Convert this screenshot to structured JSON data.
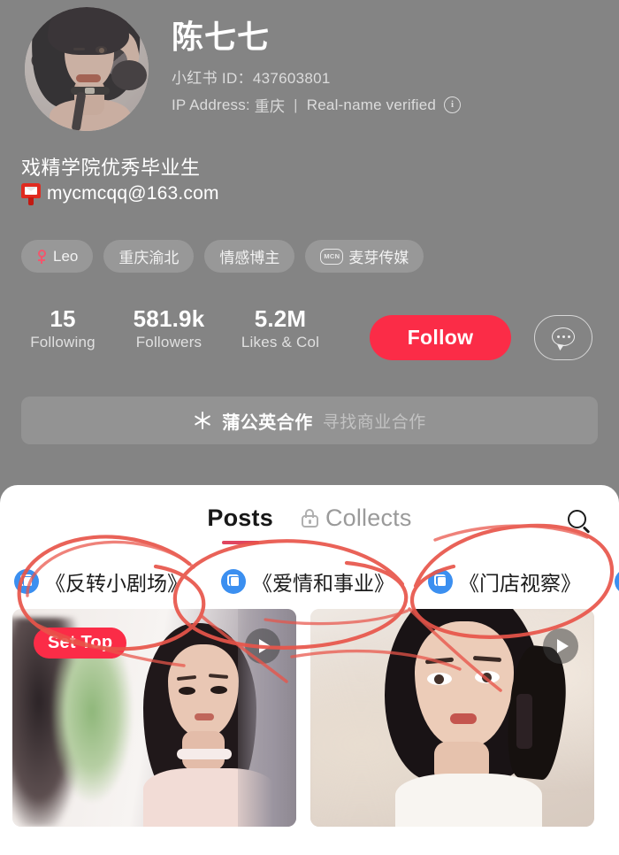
{
  "profile": {
    "username": "陈七七",
    "avatar_alt": "user-avatar",
    "id_label": "小红书 ID：",
    "id_value": "437603801",
    "ip_label": "IP Address:",
    "ip_value": "重庆",
    "separator": "|",
    "verified_text": "Real-name verified",
    "info_icon": "i",
    "bio": "戏精学院优秀毕业生",
    "email": "mycmcqq@163.com",
    "email_icon": "mailbox-icon",
    "tags": [
      {
        "label": "Leo",
        "icon": "zodiac-leo-icon"
      },
      {
        "label": "重庆渝北",
        "icon": null
      },
      {
        "label": "情感博主",
        "icon": null
      },
      {
        "label": "麦芽传媒",
        "icon": "mcn-badge",
        "badge_text": "MCN"
      }
    ],
    "stats": [
      {
        "value": "15",
        "label": "Following"
      },
      {
        "value": "581.9k",
        "label": "Followers"
      },
      {
        "value": "5.2M",
        "label": "Likes & Col"
      }
    ],
    "follow_button": "Follow",
    "message_button_icon": "chat-bubble-icon"
  },
  "cooperation": {
    "icon": "dandelion-icon",
    "title": "蒲公英合作",
    "subtitle": "寻找商业合作"
  },
  "content": {
    "tabs": [
      {
        "label": "Posts",
        "active": true,
        "icon": null
      },
      {
        "label": "Collects",
        "active": false,
        "icon": "lock-icon"
      }
    ],
    "search_icon": "search-icon",
    "collections": [
      {
        "label": "《反转小剧场》",
        "icon": "album-icon"
      },
      {
        "label": "《爱情和事业》",
        "icon": "album-icon"
      },
      {
        "label": "《门店视察》",
        "icon": "album-icon"
      }
    ],
    "cards": [
      {
        "badge": "Set Top",
        "play_icon": "play-icon",
        "art": "card-1-thumbnail"
      },
      {
        "badge": null,
        "play_icon": "play-icon",
        "art": "card-2-thumbnail"
      }
    ]
  },
  "colors": {
    "background": "#848484",
    "accent_red": "#fb2c47",
    "tab_underline": "#e0455f",
    "annotation_red": "#e8554a",
    "panel_white": "#ffffff",
    "album_blue": "#3b8ff0"
  },
  "annotations": {
    "type": "hand-drawn-red-circles",
    "count": 3,
    "targets": [
      "《反转小剧场》",
      "《爱情和事业》",
      "《门店视察》"
    ]
  }
}
